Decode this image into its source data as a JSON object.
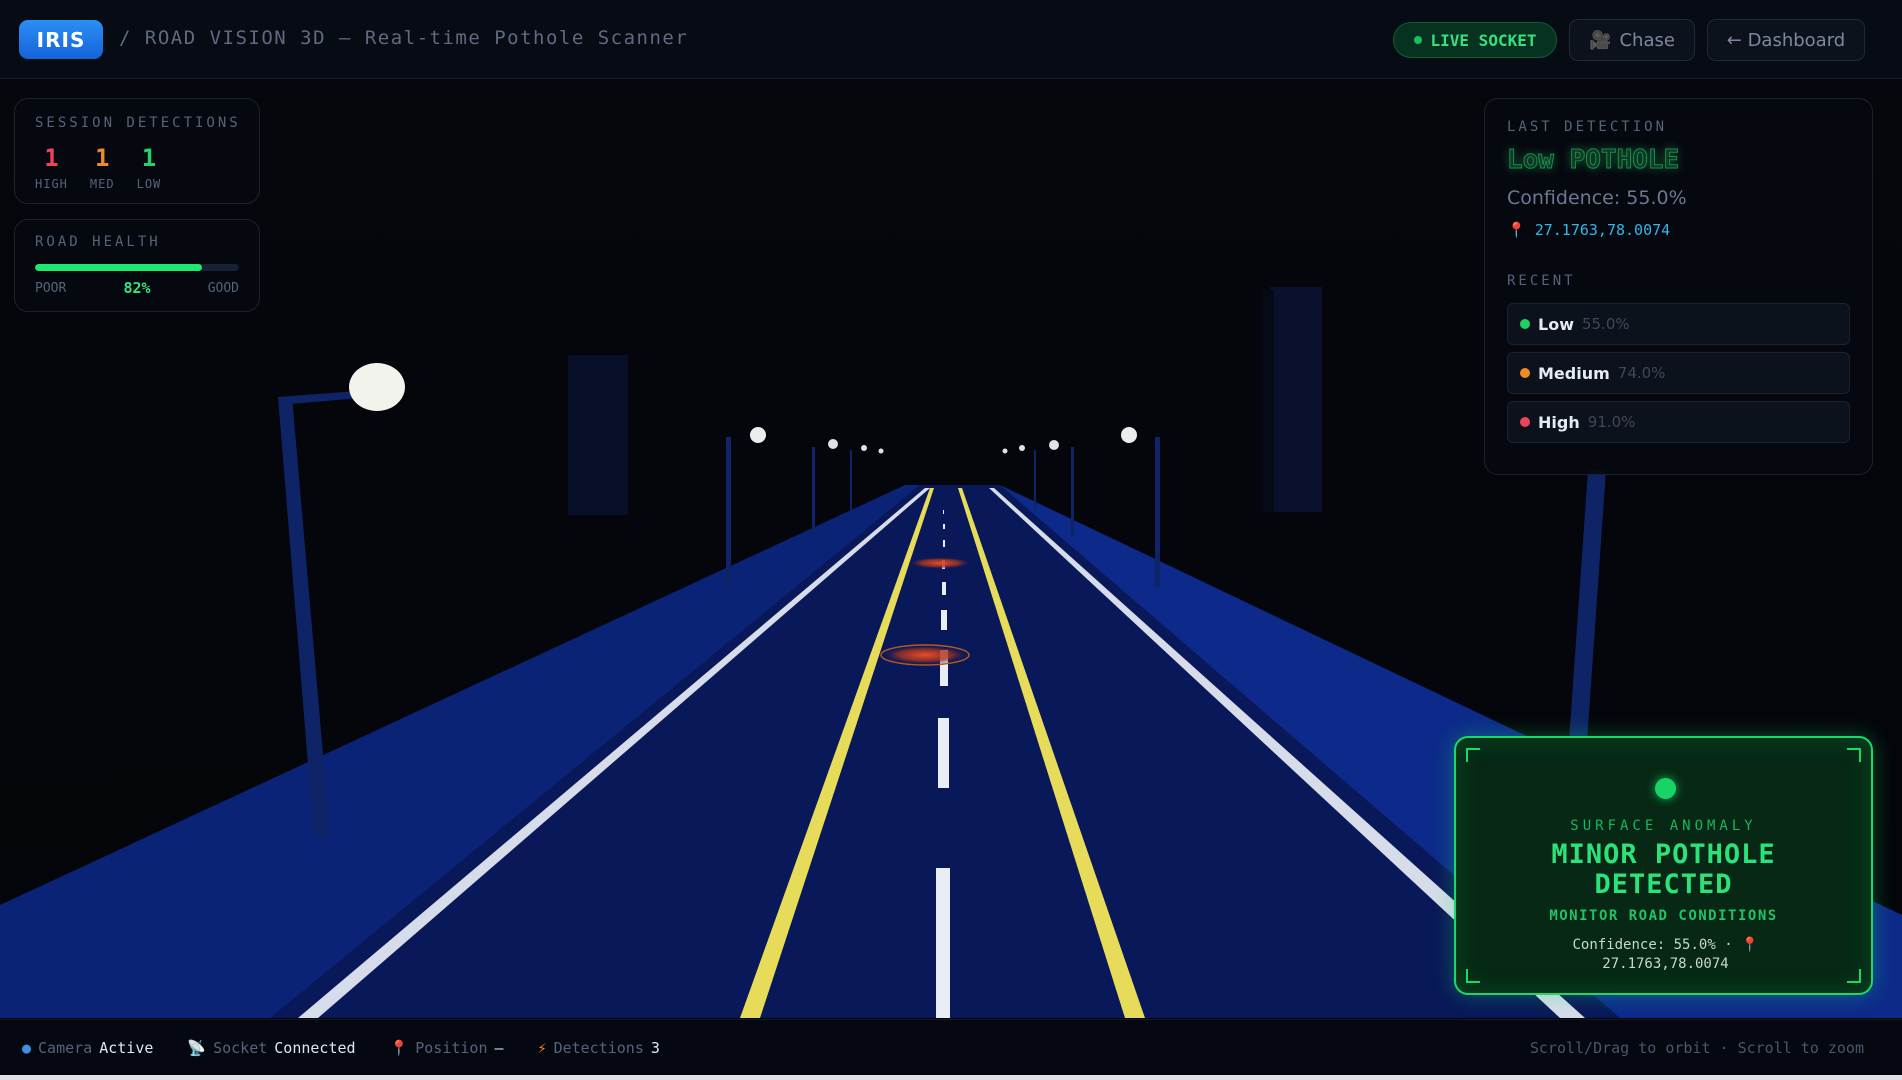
{
  "header": {
    "logo": "IRIS",
    "title": "/ ROAD VISION 3D — Real-time Pothole Scanner",
    "live_label": "LIVE SOCKET",
    "chase_label": "Chase",
    "dashboard_label": "← Dashboard"
  },
  "session": {
    "label": "SESSION DETECTIONS",
    "counts": [
      {
        "value": "1",
        "label": "HIGH",
        "color": "#f0435a"
      },
      {
        "value": "1",
        "label": "MED",
        "color": "#f08a24"
      },
      {
        "value": "1",
        "label": "LOW",
        "color": "#22d46a"
      }
    ]
  },
  "road_health": {
    "label": "ROAD HEALTH",
    "poor": "POOR",
    "good": "GOOD",
    "value_text": "82%",
    "fraction": 0.82
  },
  "last_detection": {
    "label": "LAST DETECTION",
    "title": "Low POTHOLE",
    "confidence": "Confidence: 55.0%",
    "coords": "27.1763,78.0074",
    "recent_label": "RECENT",
    "recent": [
      {
        "name": "Low",
        "confidence": "55.0%",
        "color": "#20d162"
      },
      {
        "name": "Medium",
        "confidence": "74.0%",
        "color": "#f08a24"
      },
      {
        "name": "High",
        "confidence": "91.0%",
        "color": "#f0435a"
      }
    ]
  },
  "alert": {
    "kicker": "SURFACE ANOMALY",
    "title_line1": "MINOR POTHOLE",
    "title_line2": "DETECTED",
    "subtitle": "MONITOR ROAD CONDITIONS",
    "meta_line1": "Confidence: 55.0% · 📍",
    "meta_line2": "27.1763,78.0074"
  },
  "status": {
    "camera_label": "Camera",
    "camera_value": "Active",
    "socket_label": "Socket",
    "socket_value": "Connected",
    "position_label": "Position",
    "position_value": "—",
    "detections_label": "Detections",
    "detections_value": "3",
    "help": "Scroll/Drag to orbit · Scroll to zoom"
  },
  "icons": {
    "chase": "camera-icon",
    "pin": "map-pin-icon",
    "camera": "globe-icon",
    "socket": "satellite-icon",
    "detections": "lightning-icon"
  },
  "colors": {
    "accent_blue": "#2b8ff5",
    "success_green": "#1bd86a",
    "road_blue": "#0b1a5e",
    "lane_yellow": "#e6dc5a"
  }
}
